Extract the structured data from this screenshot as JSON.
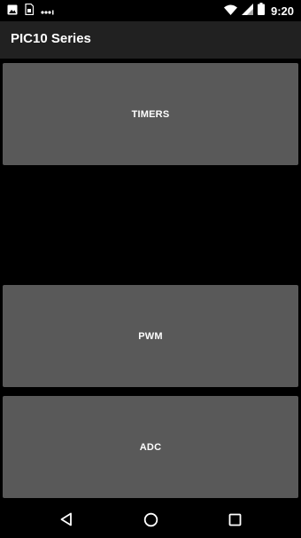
{
  "status_bar": {
    "time": "9:20",
    "left_icons": [
      "image-icon",
      "sim-card-icon",
      "more-dots-icon"
    ],
    "right_icons": [
      "wifi-icon",
      "signal-icon",
      "battery-icon"
    ]
  },
  "app_bar": {
    "title": "PIC10 Series"
  },
  "menu": {
    "items": [
      {
        "label": "TIMERS"
      },
      {
        "label": "PWM"
      },
      {
        "label": "ADC"
      }
    ]
  },
  "nav_bar": {
    "buttons": [
      "back-icon",
      "home-icon",
      "recents-icon"
    ]
  },
  "colors": {
    "background": "#000000",
    "app_bar": "#212121",
    "button": "#595959",
    "text": "#ffffff"
  }
}
